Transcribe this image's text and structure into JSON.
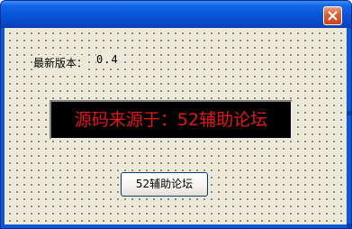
{
  "window": {
    "title": ""
  },
  "form": {
    "version_label": "最新版本：",
    "version_value": "0.4",
    "source_text": "源码来源于：52辅助论坛",
    "forum_button_label": "52辅助论坛"
  },
  "icons": {
    "close": "close-icon"
  },
  "colors": {
    "titlebar": "#0a55d8",
    "close_button": "#d9603a",
    "client_background": "#ece9d8",
    "source_panel_background": "#000000",
    "source_text": "#e8141e"
  }
}
